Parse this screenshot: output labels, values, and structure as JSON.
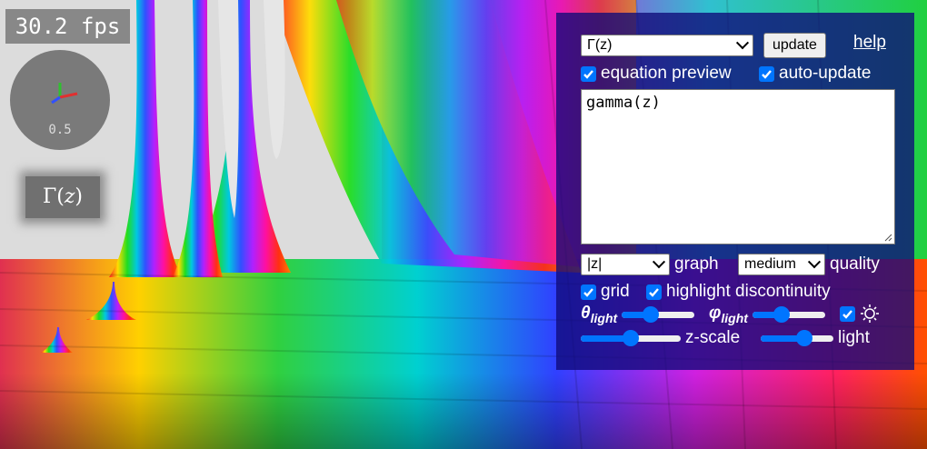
{
  "hud": {
    "fps": "30.2 fps",
    "axes_scale": "0.5",
    "function_label": "Γ(z)",
    "function_letter": "Γ",
    "function_arg": "z"
  },
  "panel": {
    "function_select": {
      "selected": "Γ(z)"
    },
    "update_label": "update",
    "help_label": "help",
    "equation_preview": {
      "label": "equation preview",
      "checked": true
    },
    "auto_update": {
      "label": "auto-update",
      "checked": true
    },
    "equation_text": "gamma(z)",
    "graph_select": {
      "selected": "|z|"
    },
    "graph_label": "graph",
    "quality_select": {
      "selected": "medium"
    },
    "quality_label": "quality",
    "grid": {
      "label": "grid",
      "checked": true
    },
    "highlight_discontinuity": {
      "label": "highlight discontinuity",
      "checked": true
    },
    "theta_light": {
      "symbol": "θ",
      "sub": "light",
      "value": 0.4
    },
    "phi_light": {
      "symbol": "φ",
      "sub": "light",
      "value": 0.4
    },
    "sun_toggle": {
      "checked": true,
      "icon": "sun-icon"
    },
    "z_scale": {
      "label": "z-scale",
      "value": 0.5
    },
    "light": {
      "label": "light",
      "value": 0.6
    }
  },
  "colors": {
    "panel": "#0f0a78",
    "accent": "#0075ff"
  }
}
